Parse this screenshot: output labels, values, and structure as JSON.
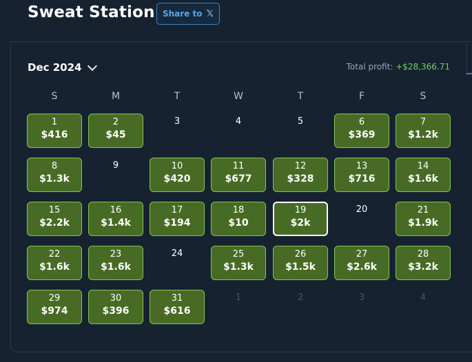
{
  "header": {
    "title": "Sweat Station",
    "share_label": "Share to",
    "share_icon": "x-logo-icon"
  },
  "calendar": {
    "month": "Dec 2024",
    "total_label": "Total profit:",
    "total_value": "+$28,366.71",
    "weekdays": [
      "S",
      "M",
      "T",
      "W",
      "T",
      "F",
      "S"
    ],
    "weeks": [
      [
        {
          "day": "1",
          "amount": "$416"
        },
        {
          "day": "2",
          "amount": "$45"
        },
        {
          "day": "3",
          "amount": null
        },
        {
          "day": "4",
          "amount": null
        },
        {
          "day": "5",
          "amount": null
        },
        {
          "day": "6",
          "amount": "$369"
        },
        {
          "day": "7",
          "amount": "$1.2k"
        }
      ],
      [
        {
          "day": "8",
          "amount": "$1.3k"
        },
        {
          "day": "9",
          "amount": null
        },
        {
          "day": "10",
          "amount": "$420"
        },
        {
          "day": "11",
          "amount": "$677"
        },
        {
          "day": "12",
          "amount": "$328"
        },
        {
          "day": "13",
          "amount": "$716"
        },
        {
          "day": "14",
          "amount": "$1.6k"
        }
      ],
      [
        {
          "day": "15",
          "amount": "$2.2k"
        },
        {
          "day": "16",
          "amount": "$1.4k"
        },
        {
          "day": "17",
          "amount": "$194"
        },
        {
          "day": "18",
          "amount": "$10"
        },
        {
          "day": "19",
          "amount": "$2k",
          "selected": true
        },
        {
          "day": "20",
          "amount": null
        },
        {
          "day": "21",
          "amount": "$1.9k"
        }
      ],
      [
        {
          "day": "22",
          "amount": "$1.6k"
        },
        {
          "day": "23",
          "amount": "$1.6k"
        },
        {
          "day": "24",
          "amount": null
        },
        {
          "day": "25",
          "amount": "$1.3k"
        },
        {
          "day": "26",
          "amount": "$1.5k"
        },
        {
          "day": "27",
          "amount": "$2.6k"
        },
        {
          "day": "28",
          "amount": "$3.2k"
        }
      ],
      [
        {
          "day": "29",
          "amount": "$974"
        },
        {
          "day": "30",
          "amount": "$396"
        },
        {
          "day": "31",
          "amount": "$616"
        },
        {
          "day": "1",
          "amount": null,
          "muted": true
        },
        {
          "day": "2",
          "amount": null,
          "muted": true
        },
        {
          "day": "3",
          "amount": null,
          "muted": true
        },
        {
          "day": "4",
          "amount": null,
          "muted": true
        }
      ]
    ]
  },
  "colors": {
    "active_bg": "#476b24",
    "active_border": "#86c25a",
    "profit": "#6fd16b",
    "accent": "#3b82c4"
  }
}
